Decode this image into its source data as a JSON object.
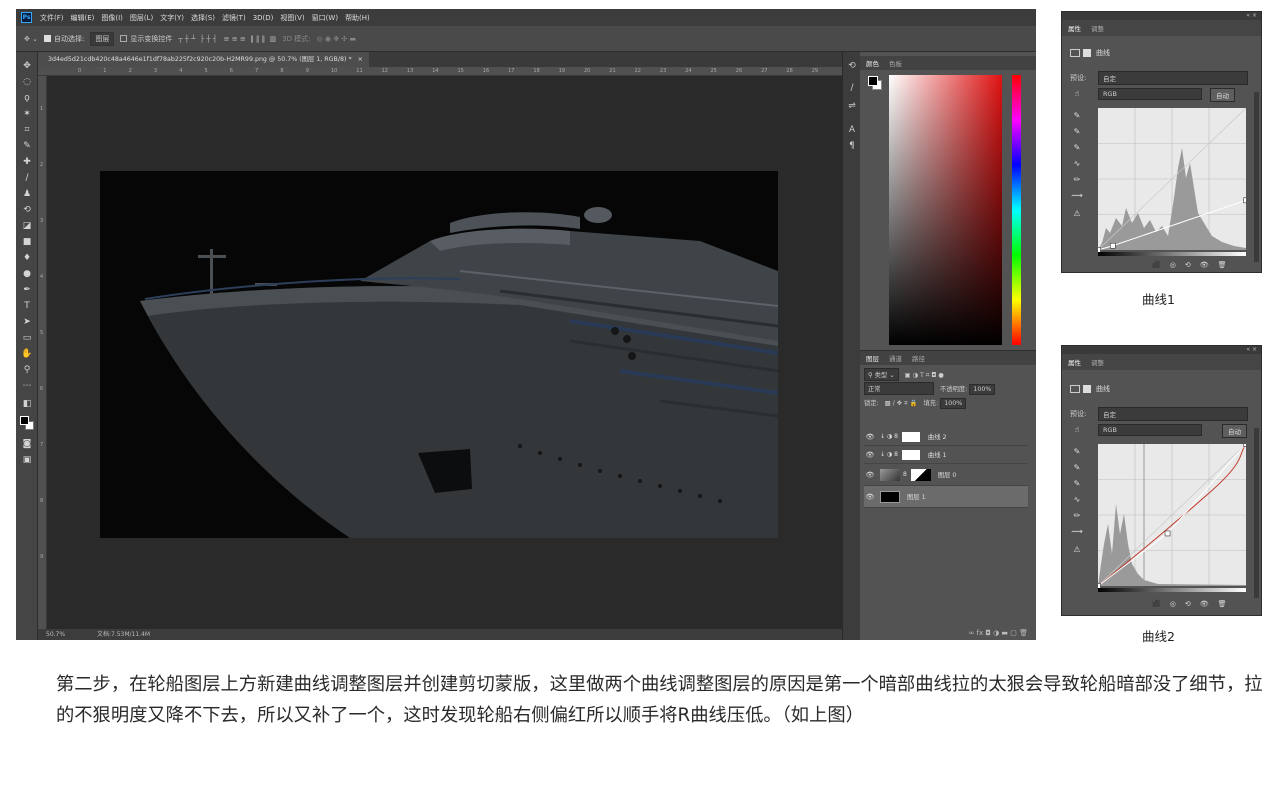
{
  "app": {
    "logo": "Ps",
    "menu": [
      "文件(F)",
      "编辑(E)",
      "图像(I)",
      "图层(L)",
      "文字(Y)",
      "选择(S)",
      "滤镜(T)",
      "3D(D)",
      "视图(V)",
      "窗口(W)",
      "帮助(H)"
    ]
  },
  "options": {
    "auto_select_label": "自动选择:",
    "auto_select_value": "图层",
    "show_transform_label": "显示变换控件",
    "mode_3d_label": "3D 模式:"
  },
  "document": {
    "tab_title": "3d4ed5d21cdb420c48a4646e1f1df78ab225f2c920c20b-H2MR99.png @ 50.7% (图层 1, RGB/8) *",
    "zoom": "50.7%",
    "doc_info": "文档:7.53M/11.4M",
    "ruler_top": [
      "0",
      "1",
      "2",
      "3",
      "4",
      "5",
      "6",
      "7",
      "8",
      "9",
      "10",
      "11",
      "12",
      "13",
      "14",
      "15",
      "16",
      "17",
      "18",
      "19",
      "20",
      "21",
      "22",
      "23",
      "24",
      "25",
      "26",
      "27",
      "28",
      "29"
    ],
    "ruler_left": [
      "1",
      "2",
      "3",
      "4",
      "5",
      "6",
      "7",
      "8",
      "9"
    ]
  },
  "color_panel": {
    "tabs": [
      "颜色",
      "色板"
    ],
    "hue_color": "#e01212"
  },
  "layers_panel": {
    "tabs": [
      "图层",
      "通道",
      "路径"
    ],
    "kind_filter": "类型",
    "blend_mode": "正常",
    "opacity_label": "不透明度:",
    "opacity_value": "100%",
    "lock_label": "锁定:",
    "fill_label": "填充:",
    "fill_value": "100%",
    "layers": [
      {
        "name": "曲线 2"
      },
      {
        "name": "曲线 1"
      },
      {
        "name": "图层 0"
      },
      {
        "name": "图层 1"
      }
    ]
  },
  "properties_panels": [
    {
      "tabs": [
        "属性",
        "调整"
      ],
      "title": "曲线",
      "preset_label": "预设:",
      "preset_value": "自定",
      "channel": "RGB",
      "auto_label": "自动",
      "caption": "曲线1",
      "curve_points": [
        [
          0,
          0
        ],
        [
          0.1,
          0.03
        ],
        [
          1,
          0.35
        ]
      ],
      "red_curve": false
    },
    {
      "tabs": [
        "属性",
        "调整"
      ],
      "title": "曲线",
      "preset_label": "预设:",
      "preset_value": "自定",
      "channel": "RGB",
      "auto_label": "自动",
      "caption": "曲线2",
      "curve_points": [
        [
          0,
          0
        ],
        [
          0.47,
          0.37
        ],
        [
          1,
          1
        ]
      ],
      "red_curve": true
    }
  ],
  "article": {
    "paragraph": "第二步，在轮船图层上方新建曲线调整图层并创建剪切蒙版，这里做两个曲线调整图层的原因是第一个暗部曲线拉的太狠会导致轮船暗部没了细节，拉的不狠明度又降不下去，所以又补了一个，这时发现轮船右侧偏红所以顺手将R曲线压低。（如上图）"
  }
}
